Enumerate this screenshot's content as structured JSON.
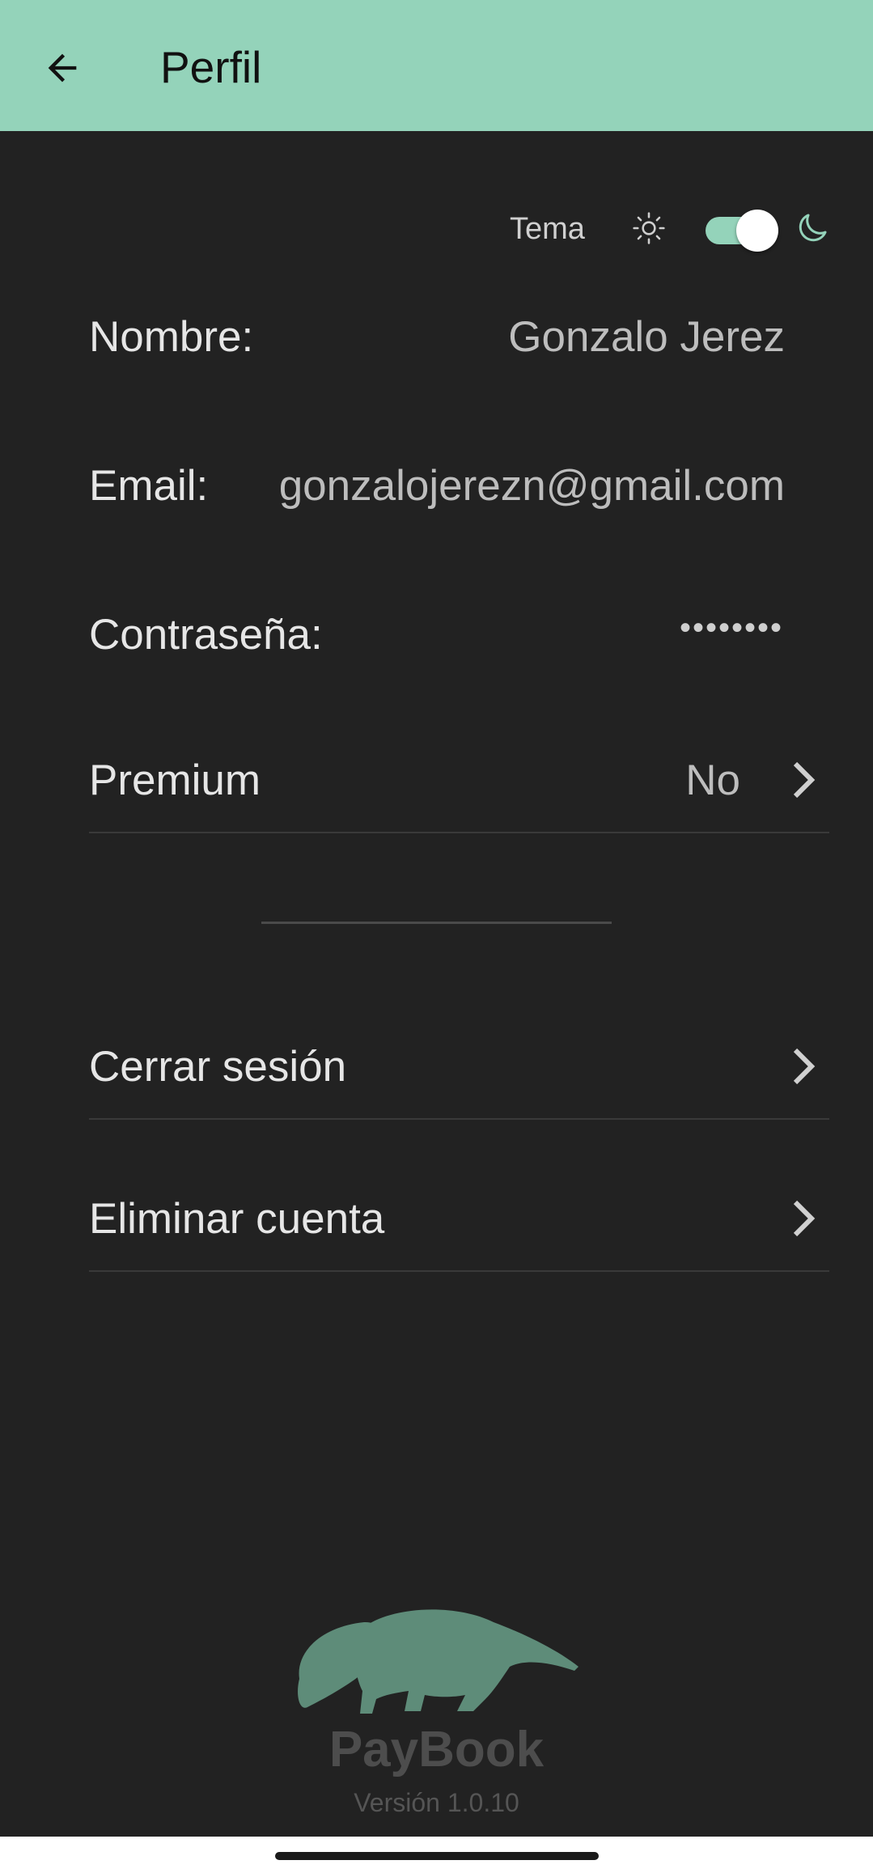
{
  "header": {
    "title": "Perfil",
    "back_icon": "arrow-left-icon",
    "background": "#94D3BA"
  },
  "theme": {
    "label": "Tema",
    "light_icon": "sun-icon",
    "dark_icon": "moon-icon",
    "dark_mode_enabled": true,
    "accent": "#94D3BA"
  },
  "profile": {
    "name_label": "Nombre:",
    "name_value": "Gonzalo Jerez",
    "email_label": "Email:",
    "email_value": "gonzalojerezn@gmail.com",
    "password_label": "Contraseña:",
    "password_value": "••••••••"
  },
  "menu": {
    "premium_label": "Premium",
    "premium_value": "No",
    "logout_label": "Cerrar sesión",
    "delete_label": "Eliminar cuenta"
  },
  "footer": {
    "brand": "PayBook",
    "version": "Versión 1.0.10",
    "logo_icon": "anteater-logo-icon"
  }
}
